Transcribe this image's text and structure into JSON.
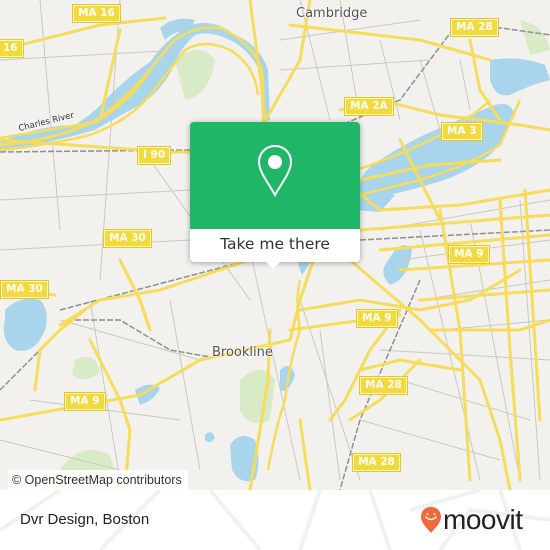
{
  "map": {
    "place_labels": {
      "cambridge": "Cambridge",
      "brookline": "Brookline"
    },
    "water_labels": {
      "charles_river": "Charles River"
    },
    "route_shields": [
      {
        "id": "ma16-top",
        "label": "MA 16"
      },
      {
        "id": "ma16-left",
        "label": "16"
      },
      {
        "id": "i90",
        "label": "I 90"
      },
      {
        "id": "ma28-top",
        "label": "MA 28"
      },
      {
        "id": "ma2a",
        "label": "MA 2A"
      },
      {
        "id": "ma3",
        "label": "MA 3"
      },
      {
        "id": "ma30-mid",
        "label": "MA 30"
      },
      {
        "id": "ma30-left",
        "label": "MA 30"
      },
      {
        "id": "ma9-right",
        "label": "MA 9"
      },
      {
        "id": "ma9-mid",
        "label": "MA 9"
      },
      {
        "id": "ma9-left",
        "label": "MA 9"
      },
      {
        "id": "ma28-mid",
        "label": "MA 28"
      },
      {
        "id": "ma28-low",
        "label": "MA 28"
      }
    ],
    "colors": {
      "land": "#f2f1ee",
      "water": "#a8d4ec",
      "park": "#d9ebc6",
      "road": "#f6dc5a",
      "minor_road": "#c9c6c0",
      "rail": "#8a8a8a"
    },
    "attribution": "© OpenStreetMap contributors"
  },
  "popup": {
    "icon": "map-pin-icon",
    "button_label": "Take me there",
    "accent_color": "#1fb767"
  },
  "footer": {
    "place_name": "Dvr Design, Boston",
    "brand": "moovit",
    "brand_color": "#f1693a"
  }
}
